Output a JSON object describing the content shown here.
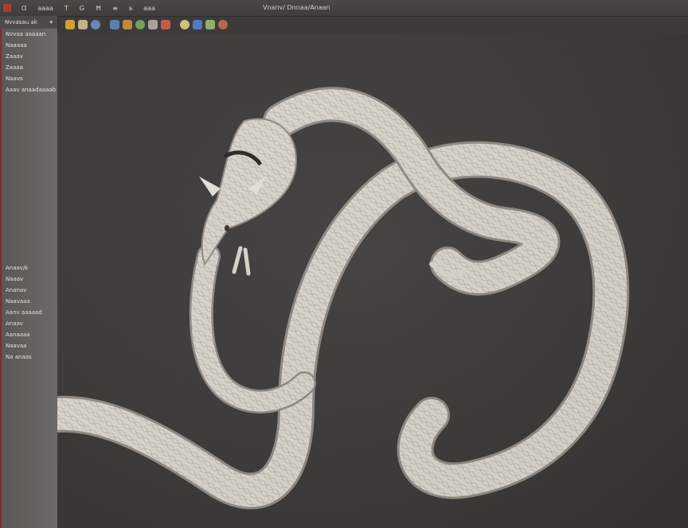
{
  "window": {
    "title": "Vnanv/ Dnnaa/Anaan"
  },
  "menubar": {
    "items": [
      "Ƀ",
      "Ɑ",
      "aaaa",
      "T",
      "G",
      "Ħ",
      "≡",
      "ꞩ",
      "aaa"
    ]
  },
  "toolbar": {
    "tools": [
      {
        "icon": "brush-icon",
        "color": "#d4a035"
      },
      {
        "icon": "palette-icon",
        "color": "#c7b08a"
      },
      {
        "icon": "smudge-icon",
        "color": "#6a86b6"
      },
      {
        "icon": "globe-icon",
        "color": "#5a7fb0"
      },
      {
        "icon": "layer-icon",
        "color": "#c08a3c"
      },
      {
        "icon": "leaf-icon",
        "color": "#74a05a"
      },
      {
        "icon": "eyedropper-icon",
        "color": "#a8a29a"
      },
      {
        "icon": "sphere-icon",
        "color": "#c25c4a"
      },
      {
        "icon": "pen-icon",
        "color": "#d0c080"
      },
      {
        "icon": "blue-sphere-icon",
        "color": "#4f7bc4"
      },
      {
        "icon": "wand-icon",
        "color": "#8fae6c"
      },
      {
        "icon": "bug-icon",
        "color": "#b06a50"
      }
    ]
  },
  "sidebar": {
    "header": "Nvvasau ak",
    "top_items": [
      "Nvvaa aaaaan",
      "Naaaaa",
      "Zaaav",
      "Zaaaa",
      "Naavs",
      "Aaav anaadaaaab"
    ],
    "bottom_items": [
      "Anaav/k",
      "Naaav",
      "Ananav",
      "Naavaaa",
      "Aanv aaaaad",
      "Anaav",
      "Aanaaaa",
      "Naavaa",
      "Na anaas"
    ]
  },
  "colors": {
    "accent": "#b33a33",
    "canvas": "#3d3b39",
    "creature": "#d8d3cb"
  }
}
